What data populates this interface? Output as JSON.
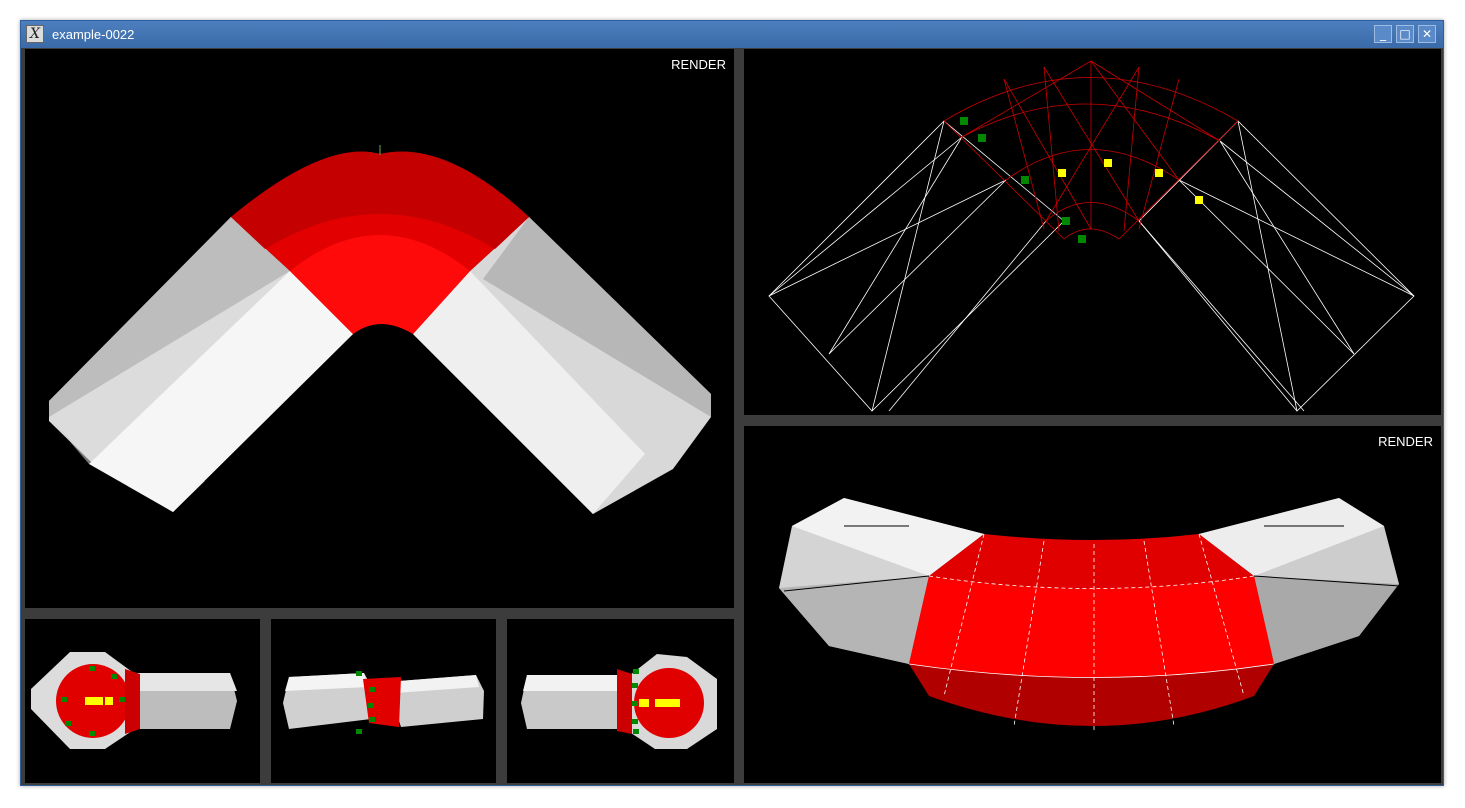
{
  "window": {
    "title": "example-0022",
    "app_icon": "x-window-icon",
    "controls": {
      "minimize": "minimize-icon",
      "maximize": "maximize-icon",
      "close": "close-icon"
    }
  },
  "viewports": {
    "main": {
      "label": "RENDER"
    },
    "wireframe": {
      "label": ""
    },
    "render_side": {
      "label": "RENDER"
    },
    "front": {
      "label": ""
    },
    "top": {
      "label": ""
    },
    "back": {
      "label": ""
    }
  },
  "colors": {
    "background": "#000000",
    "separator": "#3c3c3c",
    "pipe_red": "#ff0000",
    "pipe_white": "#e6e6e6",
    "control_point_green": "#008800",
    "control_point_yellow": "#ffff00"
  }
}
